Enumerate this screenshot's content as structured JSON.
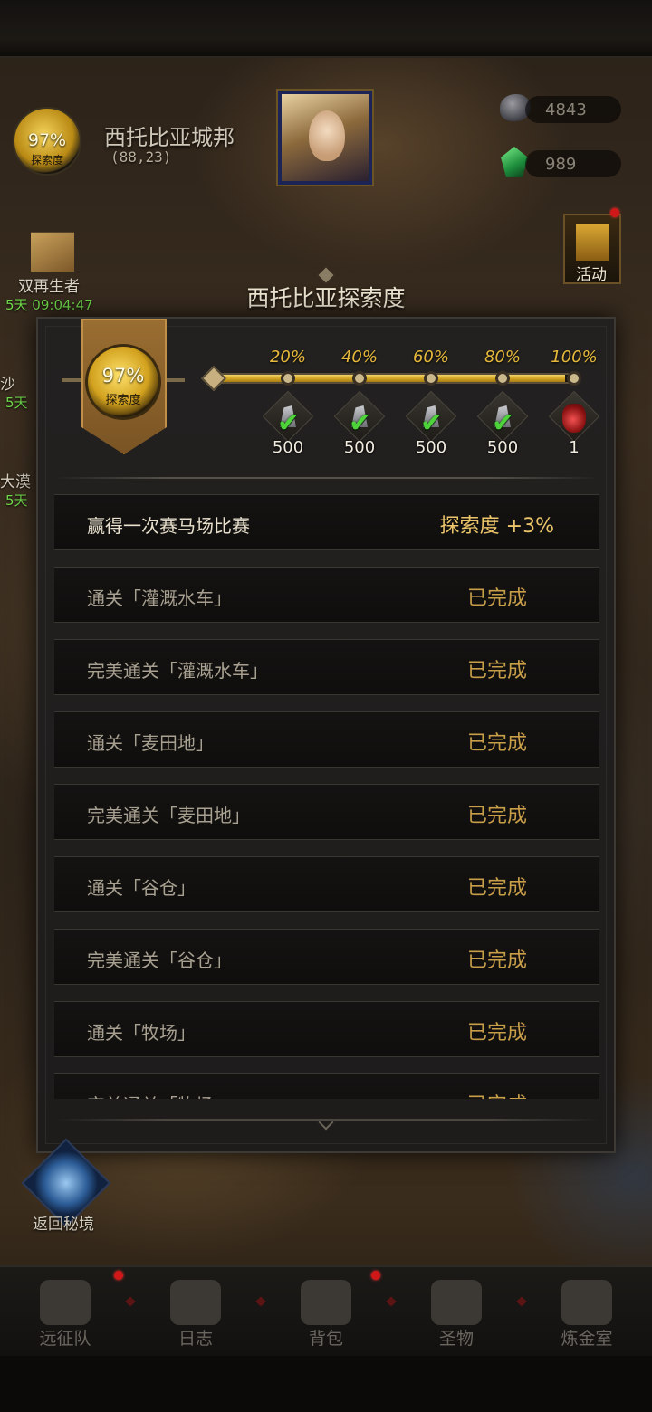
{
  "region": {
    "exploration_pct": "97%",
    "exploration_label": "探索度",
    "name": "西托比亚城邦",
    "coords": "(88,23)"
  },
  "currencies": [
    {
      "icon": "stone-icon",
      "value": "4843"
    },
    {
      "icon": "gem-icon",
      "value": "989"
    }
  ],
  "side_widgets": {
    "gift_label": "双再生者",
    "gift_timer": "5天 09:04:47",
    "activity_label": "活动",
    "partial_items": [
      {
        "label": "沙",
        "timer": "5天"
      },
      {
        "label": "大漠",
        "timer": "5天"
      }
    ]
  },
  "modal": {
    "title": "西托比亚探索度",
    "gauge_pct": "97%",
    "gauge_label": "探索度",
    "progress_fraction": 0.97,
    "milestones": [
      {
        "pct": "20%",
        "reward": "500",
        "claimed": true
      },
      {
        "pct": "40%",
        "reward": "500",
        "claimed": true
      },
      {
        "pct": "60%",
        "reward": "500",
        "claimed": true
      },
      {
        "pct": "80%",
        "reward": "500",
        "claimed": true
      },
      {
        "pct": "100%",
        "reward": "1",
        "claimed": false
      }
    ],
    "tasks": [
      {
        "name": "赢得一次赛马场比赛",
        "status": "探索度 +3%"
      },
      {
        "name": "通关「灌溉水车」",
        "status": "已完成"
      },
      {
        "name": "完美通关「灌溉水车」",
        "status": "已完成"
      },
      {
        "name": "通关「麦田地」",
        "status": "已完成"
      },
      {
        "name": "完美通关「麦田地」",
        "status": "已完成"
      },
      {
        "name": "通关「谷仓」",
        "status": "已完成"
      },
      {
        "name": "完美通关「谷仓」",
        "status": "已完成"
      },
      {
        "name": "通关「牧场」",
        "status": "已完成"
      },
      {
        "name": "完美通关「牧场」",
        "status": "已完成"
      }
    ]
  },
  "return_label": "返回秘境",
  "bottom_nav": [
    {
      "label": "远征队",
      "icon": "helmet-icon"
    },
    {
      "label": "日志",
      "icon": "map-scroll-icon"
    },
    {
      "label": "背包",
      "icon": "bag-icon"
    },
    {
      "label": "圣物",
      "icon": "brazier-icon"
    },
    {
      "label": "炼金室",
      "icon": "alchemy-icon"
    }
  ]
}
